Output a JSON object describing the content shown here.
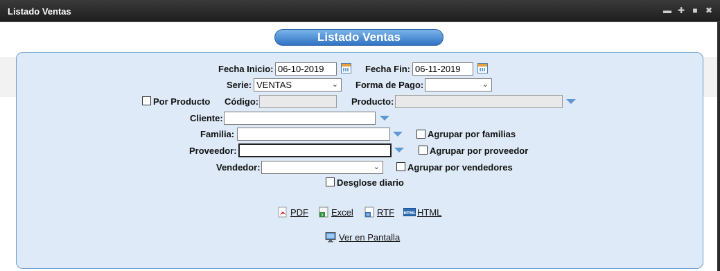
{
  "window": {
    "title": "Listado Ventas",
    "buttons": [
      "minimize",
      "move",
      "maximize",
      "close"
    ]
  },
  "header": {
    "title": "Listado Ventas"
  },
  "form": {
    "fecha_inicio": {
      "label": "Fecha Inicio:",
      "value": "06-10-2019"
    },
    "fecha_fin": {
      "label": "Fecha Fin:",
      "value": "06-11-2019"
    },
    "serie": {
      "label": "Serie:",
      "value": "VENTAS"
    },
    "forma_pago": {
      "label": "Forma de Pago:",
      "value": ""
    },
    "por_producto": {
      "label": "Por Producto",
      "checked": false
    },
    "codigo": {
      "label": "Código:",
      "value": ""
    },
    "producto": {
      "label": "Producto:",
      "value": ""
    },
    "cliente": {
      "label": "Cliente:",
      "value": ""
    },
    "familia": {
      "label": "Familia:",
      "value": ""
    },
    "agrupar_familias": {
      "label": "Agrupar por familias",
      "checked": false
    },
    "proveedor": {
      "label": "Proveedor:",
      "value": ""
    },
    "agrupar_proveedor": {
      "label": "Agrupar por proveedor",
      "checked": false
    },
    "vendedor": {
      "label": "Vendedor:",
      "value": ""
    },
    "agrupar_vendedores": {
      "label": "Agrupar por vendedores",
      "checked": false
    },
    "desglose_diario": {
      "label": "Desglose diario",
      "checked": false
    }
  },
  "exports": {
    "pdf": "PDF",
    "excel": "Excel",
    "rtf": "RTF",
    "html": "HTML"
  },
  "ver_en_pantalla": "Ver en Pantalla"
}
